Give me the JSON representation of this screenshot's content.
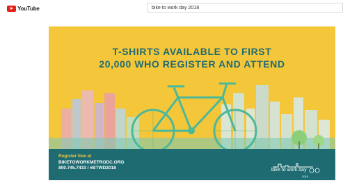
{
  "youtube": {
    "logo_text": "YouTube"
  },
  "search": {
    "query": "bike to work day 2018"
  },
  "video": {
    "headline_line1": "T-SHIRTS AVAILABLE TO FIRST",
    "headline_highlight": "20,000",
    "headline_line2_rest": " WHO REGISTER AND ATTEND",
    "register_label": "Register free at",
    "register_url": "BIKETOWORKMETRODC.ORG",
    "contact": "800.745.7433  /  #BTWD2018",
    "brand_text": "bike to work day",
    "brand_year": "2018"
  },
  "colors": {
    "background_yellow": "#f4c63a",
    "teal": "#1f6b72",
    "bike": "#4bb89a",
    "youtube_red": "#e62117"
  }
}
